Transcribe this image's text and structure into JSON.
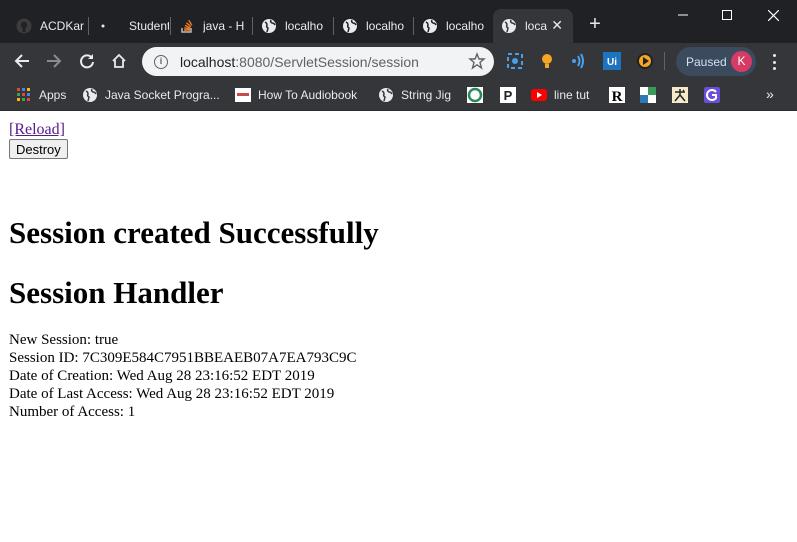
{
  "tabs": [
    {
      "title": "ACDKar",
      "icon": "github-icon"
    },
    {
      "title": "Student",
      "icon": "dot-icon"
    },
    {
      "title": "java - H",
      "icon": "stackoverflow-icon"
    },
    {
      "title": "localho",
      "icon": "globe-icon"
    },
    {
      "title": "localho",
      "icon": "globe-icon"
    },
    {
      "title": "localho",
      "icon": "globe-icon"
    },
    {
      "title": "loca",
      "icon": "globe-icon",
      "active": true
    }
  ],
  "new_tab_label": "+",
  "omnibox": {
    "host": "localhost",
    "rest": ":8080/ServletSession/session"
  },
  "profile": {
    "status": "Paused",
    "initial": "K",
    "avatar_color": "#d63b66"
  },
  "bookmarks": [
    {
      "label": "Apps",
      "icon": "apps-grid-icon"
    },
    {
      "label": "Java Socket Progra...",
      "icon": "globe-icon"
    },
    {
      "label": "How To Audiobook",
      "icon": "audiobook-icon"
    },
    {
      "label": "String Jig",
      "icon": "globe-icon"
    },
    {
      "label": "",
      "icon": "green-circle-icon"
    },
    {
      "label": "",
      "icon": "p-logo-icon"
    },
    {
      "label": "line tut",
      "icon": "youtube-icon"
    },
    {
      "label": "",
      "icon": "r-logo-icon"
    },
    {
      "label": "",
      "icon": "mountain-icon"
    },
    {
      "label": "",
      "icon": "kanji-icon"
    },
    {
      "label": "",
      "icon": "purple-g-icon"
    }
  ],
  "page": {
    "reload_text": "[Reload]",
    "destroy_label": "Destroy",
    "heading_created": "Session created Successfully",
    "heading_handler": "Session Handler",
    "lines": {
      "new_session": "New Session: true",
      "session_id": "Session ID: 7C309E584C7951BBEAEB07A7EA793C9C",
      "creation": "Date of Creation: Wed Aug 28 23:16:52 EDT 2019",
      "last_access": "Date of Last Access: Wed Aug 28 23:16:52 EDT 2019",
      "access_count": "Number of Access: 1"
    }
  },
  "colors": {
    "titlebar": "#202124",
    "toolbar": "#35363a",
    "link_visited": "#551a8b"
  }
}
